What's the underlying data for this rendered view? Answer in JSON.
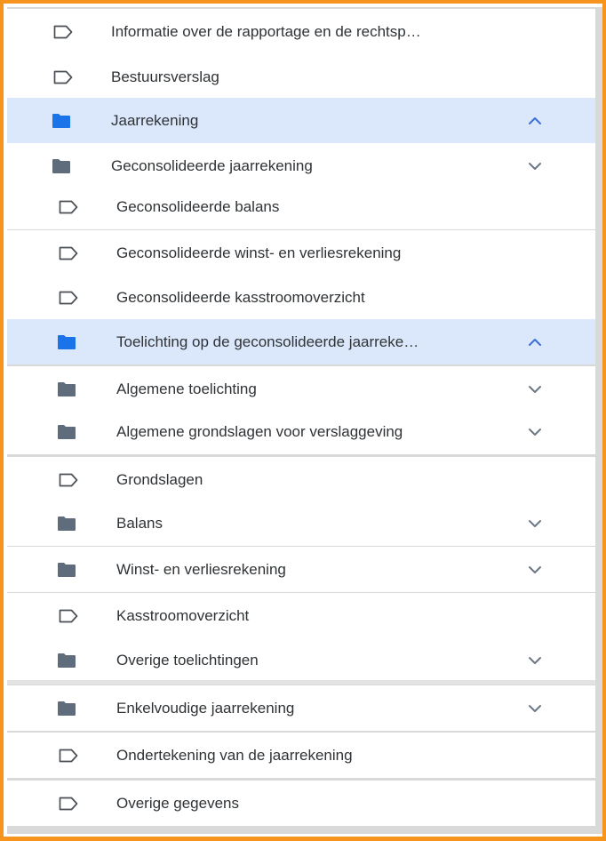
{
  "colors": {
    "frame_border": "#f7941d",
    "selected_row_bg": "#dbe7fb",
    "folder_selected": "#1a73e8",
    "folder_default": "#5f6c7b",
    "text": "#2f3336",
    "chevron": "#6b7785"
  },
  "tree": {
    "items": [
      {
        "label": "Informatie over de rapportage en de rechtsp…",
        "icon": "tag-icon"
      },
      {
        "label": "Bestuursverslag",
        "icon": "tag-icon"
      },
      {
        "label": "Jaarrekening",
        "icon": "folder-icon",
        "selected": true,
        "expanded": true
      },
      {
        "label": "Geconsolideerde jaarrekening",
        "icon": "folder-icon",
        "expanded": false
      },
      {
        "label": "Geconsolideerde balans",
        "icon": "tag-icon"
      },
      {
        "label": "Geconsolideerde winst- en verliesrekening",
        "icon": "tag-icon"
      },
      {
        "label": "Geconsolideerde kasstroomoverzicht",
        "icon": "tag-icon"
      },
      {
        "label": "Toelichting op de geconsolideerde jaarreke…",
        "icon": "folder-icon",
        "selected": true,
        "expanded": true
      },
      {
        "label": "Algemene toelichting",
        "icon": "folder-icon",
        "expanded": false
      },
      {
        "label": "Algemene grondslagen voor verslaggeving",
        "icon": "folder-icon",
        "expanded": false
      },
      {
        "label": "Grondslagen",
        "icon": "tag-icon"
      },
      {
        "label": "Balans",
        "icon": "folder-icon",
        "expanded": false
      },
      {
        "label": "Winst- en verliesrekening",
        "icon": "folder-icon",
        "expanded": false
      },
      {
        "label": "Kasstroomoverzicht",
        "icon": "tag-icon"
      },
      {
        "label": "Overige toelichtingen",
        "icon": "folder-icon",
        "expanded": false
      },
      {
        "label": "Enkelvoudige jaarrekening",
        "icon": "folder-icon",
        "expanded": false
      },
      {
        "label": "Ondertekening van de jaarrekening",
        "icon": "tag-icon"
      },
      {
        "label": "Overige gegevens",
        "icon": "tag-icon"
      }
    ]
  }
}
